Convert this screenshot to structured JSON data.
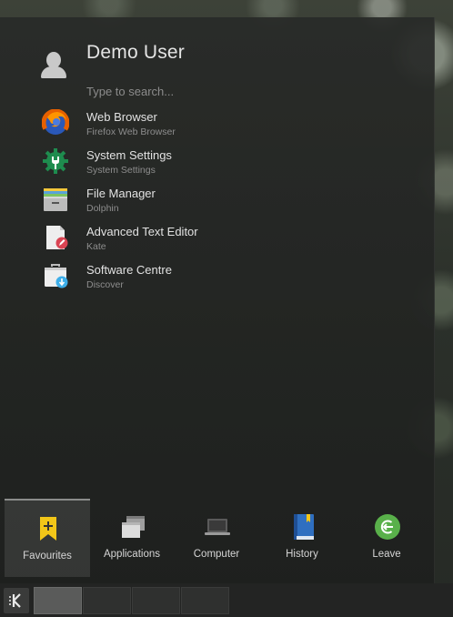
{
  "user": {
    "name": "Demo User"
  },
  "search": {
    "placeholder": "Type to search..."
  },
  "favourites": [
    {
      "name": "Web Browser",
      "description": "Firefox Web Browser",
      "icon": "firefox-icon"
    },
    {
      "name": "System Settings",
      "description": "System Settings",
      "icon": "system-settings-icon"
    },
    {
      "name": "File Manager",
      "description": "Dolphin",
      "icon": "file-manager-icon"
    },
    {
      "name": "Advanced Text Editor",
      "description": "Kate",
      "icon": "text-editor-icon"
    },
    {
      "name": "Software Centre",
      "description": "Discover",
      "icon": "software-centre-icon"
    }
  ],
  "tabs": [
    {
      "label": "Favourites",
      "icon": "bookmark-icon",
      "active": true
    },
    {
      "label": "Applications",
      "icon": "applications-icon",
      "active": false
    },
    {
      "label": "Computer",
      "icon": "computer-icon",
      "active": false
    },
    {
      "label": "History",
      "icon": "history-icon",
      "active": false
    },
    {
      "label": "Leave",
      "icon": "leave-icon",
      "active": false
    }
  ],
  "taskbar": {
    "launcher_icon": "kde-logo-icon",
    "desktops": 4,
    "current_desktop": 1
  },
  "colors": {
    "accent_yellow": "#f2c618",
    "leave_green": "#59b04a",
    "firefox_orange": "#e66000",
    "settings_green": "#1e8c4e"
  }
}
